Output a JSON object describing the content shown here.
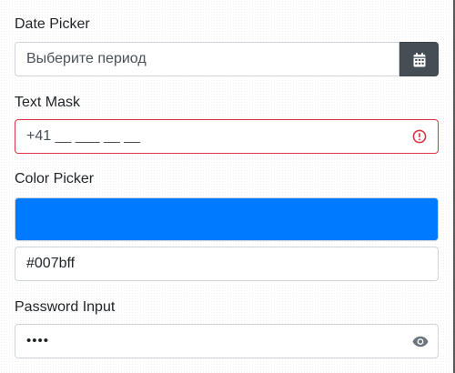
{
  "date_picker": {
    "label": "Date Picker",
    "placeholder": "Выберите период",
    "button_icon": "calendar-icon"
  },
  "text_mask": {
    "label": "Text Mask",
    "value": "+41 __ ___ __ __",
    "status_icon": "warning-circle-icon",
    "status_color": "#dc3545"
  },
  "color_picker": {
    "label": "Color Picker",
    "value": "#007bff",
    "swatch_color": "#007bff"
  },
  "password_input": {
    "label": "Password Input",
    "value": "••••",
    "toggle_icon": "eye-icon"
  }
}
